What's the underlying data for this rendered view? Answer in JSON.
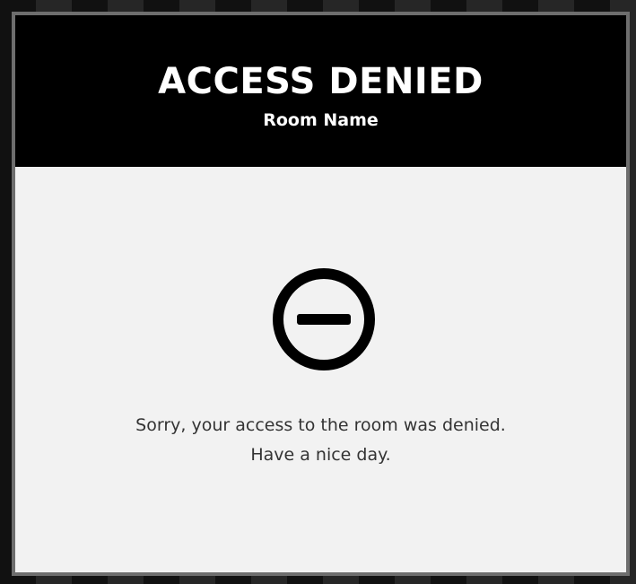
{
  "dialog": {
    "title": "ACCESS DENIED",
    "room_name": "Room Name",
    "icon": "minus-circle-icon",
    "message_line1": "Sorry, your access to the room was denied.",
    "message_line2": "Have a nice day."
  },
  "colors": {
    "header_background": "#000000",
    "header_text": "#ffffff",
    "body_background": "#f2f2f2",
    "body_text": "#333333",
    "icon": "#000000",
    "frame_border": "#6e6e6e"
  }
}
